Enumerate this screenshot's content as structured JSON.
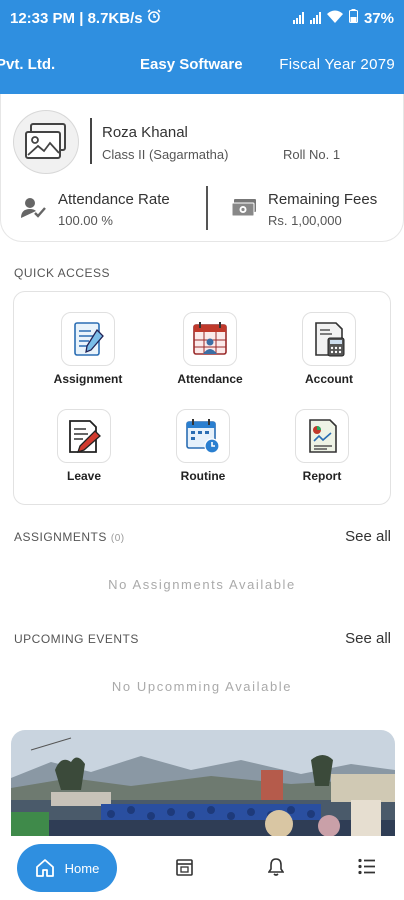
{
  "status_bar": {
    "time_speed": "12:33 PM | 8.7KB/s",
    "battery": "37%",
    "icons": [
      "alarm-icon",
      "signal-icon",
      "signal-icon",
      "wifi-icon",
      "battery-icon"
    ]
  },
  "header": {
    "company": "Pvt. Ltd.",
    "software": "Easy Software",
    "fiscal_year": "Fiscal Year 2079",
    "color": "#2f8fe0"
  },
  "profile": {
    "name": "Roza Khanal",
    "class": "Class II (Sagarmatha)",
    "roll": "Roll No. 1",
    "attendance_label": "Attendance Rate",
    "attendance_value": "100.00 %",
    "fees_label": "Remaining Fees",
    "fees_value": "Rs. 1,00,000"
  },
  "quick_access": {
    "title": "QUICK ACCESS",
    "items": [
      {
        "label": "Assignment",
        "icon": "assignment-icon"
      },
      {
        "label": "Attendance",
        "icon": "attendance-icon"
      },
      {
        "label": "Account",
        "icon": "account-icon"
      },
      {
        "label": "Leave",
        "icon": "leave-icon"
      },
      {
        "label": "Routine",
        "icon": "routine-icon"
      },
      {
        "label": "Report",
        "icon": "report-icon"
      }
    ]
  },
  "assignments": {
    "title": "ASSIGNMENTS",
    "count": "(0)",
    "see_all": "See all",
    "empty": "No Assignments Available"
  },
  "events": {
    "title": "UPCOMING EVENTS",
    "see_all": "See all",
    "empty": "No Upcomming Available"
  },
  "bottom_nav": {
    "home_label": "Home",
    "icons": [
      "home-icon",
      "calendar-icon",
      "bell-icon",
      "list-icon"
    ]
  }
}
